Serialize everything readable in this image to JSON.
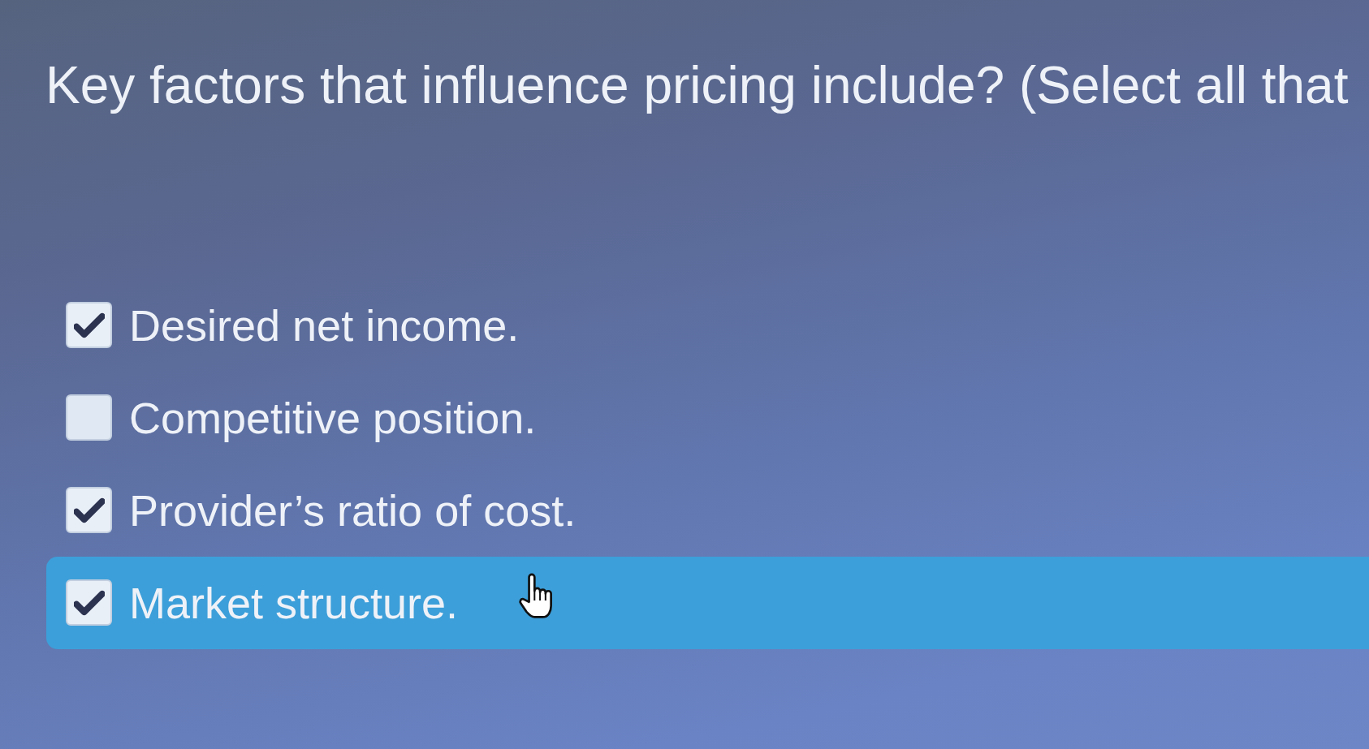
{
  "question": {
    "text": "Key factors that influence pricing include? (Select all that"
  },
  "options": [
    {
      "label": "Desired net income.",
      "checked": true,
      "highlighted": false
    },
    {
      "label": "Competitive position.",
      "checked": false,
      "highlighted": false
    },
    {
      "label": "Provider’s ratio of cost.",
      "checked": true,
      "highlighted": false
    },
    {
      "label": "Market structure.",
      "checked": true,
      "highlighted": true
    }
  ]
}
